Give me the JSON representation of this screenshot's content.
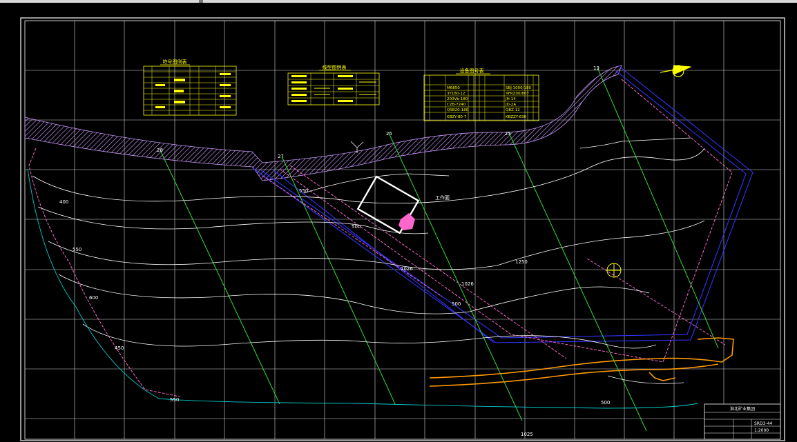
{
  "legends": {
    "symbol_legend_title": "符号图例表",
    "line_legend_title": "线型图例表",
    "equipment_table_title": "设备图号表"
  },
  "equipment_rows": [
    {
      "code": "M6850",
      "model": "SBJ-1000/180"
    },
    {
      "code": "3Y180-12",
      "model": "XFRZ00/807"
    },
    {
      "code": "200Vb-180",
      "model": "JH-14"
    },
    {
      "code": "C2B-7240",
      "model": "JD-2A"
    },
    {
      "code": "QSB20-180",
      "model": "QBZ-12"
    },
    {
      "code": "KBZY-80-7",
      "model": "KBZZY-630"
    }
  ],
  "exploration_lines": [
    "13",
    "25",
    "25",
    "27",
    "28"
  ],
  "contour_labels": [
    "400",
    "550",
    "600",
    "450",
    "550",
    "500",
    "550",
    "500",
    "500",
    "1026",
    "1025"
  ],
  "roadway_labels": [
    "1026",
    "1250"
  ],
  "annotations": [
    "工作面"
  ],
  "title_block": {
    "name": "淮北矿业集团",
    "drawing_no": "SRD3-44",
    "scale": "1:2000"
  },
  "colors": {
    "background": "#000000",
    "grid": "#ffffff",
    "legend": "#ffff00",
    "coal_seam": "#cc99ff",
    "boundary": "#3333ff",
    "mine_line": "#ff66cc",
    "exploration_line": "#33cc33",
    "contour": "#ffffff",
    "contour_alt": "#00cccc",
    "haulage": "#ff9900",
    "highlight": "#ff66cc"
  }
}
